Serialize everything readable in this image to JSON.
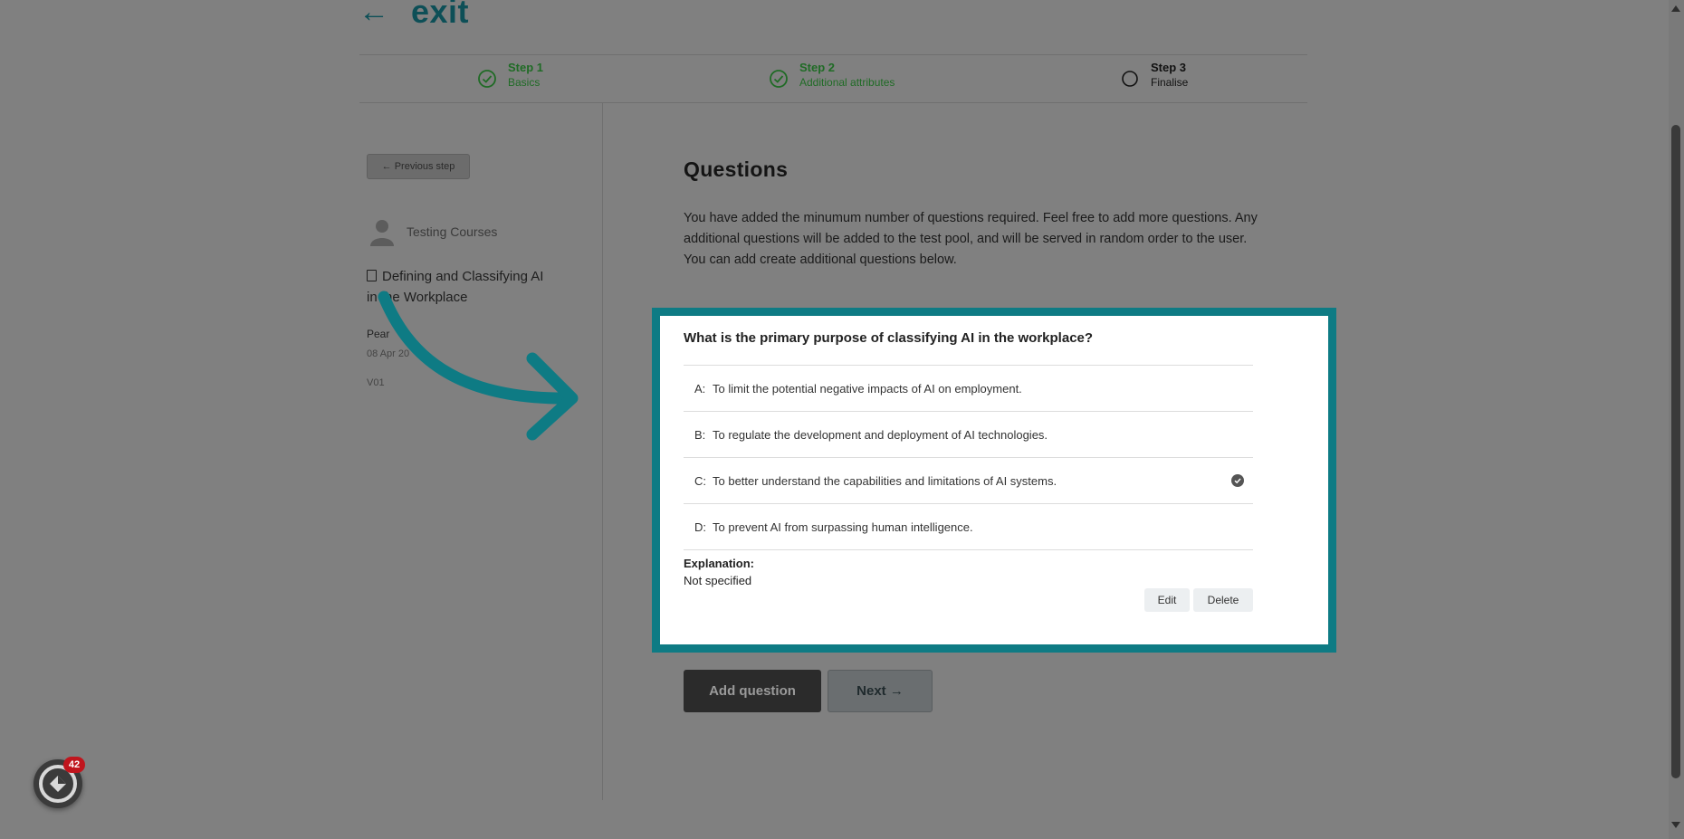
{
  "header": {
    "back_arrow": "←",
    "exit_label": "exit"
  },
  "steps": [
    {
      "title": "Step 1",
      "subtitle": "Basics",
      "status": "done"
    },
    {
      "title": "Step 2",
      "subtitle": "Additional attributes",
      "status": "done"
    },
    {
      "title": "Step 3",
      "subtitle": "Finalise",
      "status": "todo"
    }
  ],
  "sidebar": {
    "prev_step_label": "← Previous step",
    "author": "Testing Courses",
    "course_title": "Defining and Classifying AI in the Workplace",
    "meta_name": "Pear",
    "meta_date": "08 Apr 20",
    "version": "V01"
  },
  "main": {
    "heading": "Questions",
    "intro": "You have added the minumum number of questions required. Feel free to add more questions. Any additional questions will be added to the test pool, and will be served in random order to the user. You can add create additional questions below.",
    "question": {
      "text": "What is the primary purpose of classifying AI in the workplace?",
      "options": [
        {
          "letter": "A:",
          "text": "To limit the potential negative impacts of AI on employment.",
          "correct": false
        },
        {
          "letter": "B:",
          "text": "To regulate the development and deployment of AI technologies.",
          "correct": false
        },
        {
          "letter": "C:",
          "text": "To better understand the capabilities and limitations of AI systems.",
          "correct": true
        },
        {
          "letter": "D:",
          "text": "To prevent AI from surpassing human intelligence.",
          "correct": false
        }
      ],
      "explanation_label": "Explanation:",
      "explanation_value": "Not specified",
      "edit_label": "Edit",
      "delete_label": "Delete"
    },
    "add_question_label": "Add question",
    "next_label": "Next →"
  },
  "widget": {
    "badge_count": "42"
  },
  "colors": {
    "accent": "#0e7b84",
    "done_green": "#1f6b25",
    "exit_color": "#0d4f57"
  }
}
